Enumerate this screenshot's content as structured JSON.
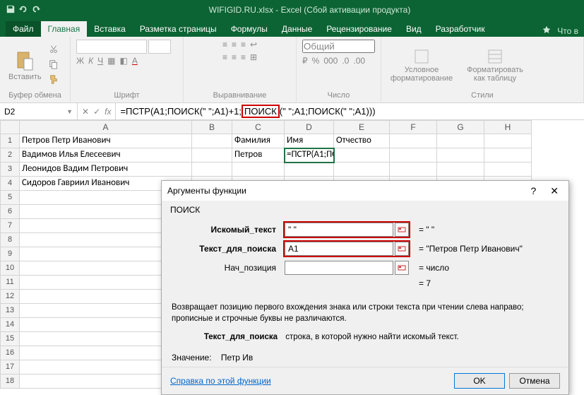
{
  "titlebar": {
    "title": "WIFIGID.RU.xlsx - Excel (Сбой активации продукта)"
  },
  "tabs": {
    "file": "Файл",
    "home": "Главная",
    "insert": "Вставка",
    "layout": "Разметка страницы",
    "formulas": "Формулы",
    "data": "Данные",
    "review": "Рецензирование",
    "view": "Вид",
    "developer": "Разработчик",
    "tell_me": "Что в"
  },
  "ribbon": {
    "paste": "Вставить",
    "clipboard": "Буфер обмена",
    "font": "Шрифт",
    "align": "Выравнивание",
    "number": "Число",
    "number_format": "Общий",
    "styles": "Стили",
    "cond_fmt": "Условное форматирование",
    "fmt_table": "Форматировать как таблицу"
  },
  "namebox": "D2",
  "formula": {
    "pre": "=ПСТР(A1;ПОИСК(\" \";A1)+1;",
    "hl": "ПОИСК",
    "post": "(\" \";A1;ПОИСК(\" \";A1)))"
  },
  "cols": [
    "A",
    "B",
    "C",
    "D",
    "E",
    "F",
    "G",
    "H"
  ],
  "rows": [
    {
      "n": "1",
      "A": "Петров Петр Иванович",
      "C": "Фамилия",
      "D": "Имя",
      "E": "Отчество"
    },
    {
      "n": "2",
      "A": "Вадимов Илья Елесеевич",
      "C": "Петров",
      "D": "=ПСТР(A1;ПОИСК(\" \";A1)+1;ПОИСК(\" \";A1;ПОИСК(\" \";A1)))"
    },
    {
      "n": "3",
      "A": "Леонидов Вадим Петрович"
    },
    {
      "n": "4",
      "A": "Сидоров Гавриил Иванович"
    },
    {
      "n": "5"
    },
    {
      "n": "6"
    },
    {
      "n": "7"
    },
    {
      "n": "8"
    },
    {
      "n": "9"
    },
    {
      "n": "10"
    },
    {
      "n": "11"
    },
    {
      "n": "12"
    },
    {
      "n": "13"
    },
    {
      "n": "14"
    },
    {
      "n": "15"
    },
    {
      "n": "16"
    },
    {
      "n": "17"
    },
    {
      "n": "18"
    }
  ],
  "dialog": {
    "title": "Аргументы функции",
    "fn": "ПОИСК",
    "args": {
      "a1_label": "Искомый_текст",
      "a1_val": "\" \"",
      "a1_res": "= \" \"",
      "a2_label": "Текст_для_поиска",
      "a2_val": "A1",
      "a2_res": "= \"Петров Петр Иванович\"",
      "a3_label": "Нач_позиция",
      "a3_val": "",
      "a3_res": "= число"
    },
    "fn_result": "= 7",
    "desc": "Возвращает позицию первого вхождения знака или строки текста при чтении слева направо; прописные и строчные буквы не различаются.",
    "param_name": "Текст_для_поиска",
    "param_desc": "строка, в которой нужно найти искомый текст.",
    "value_label": "Значение:",
    "value": "Петр Ив",
    "help": "Справка по этой функции",
    "ok": "OK",
    "cancel": "Отмена"
  }
}
